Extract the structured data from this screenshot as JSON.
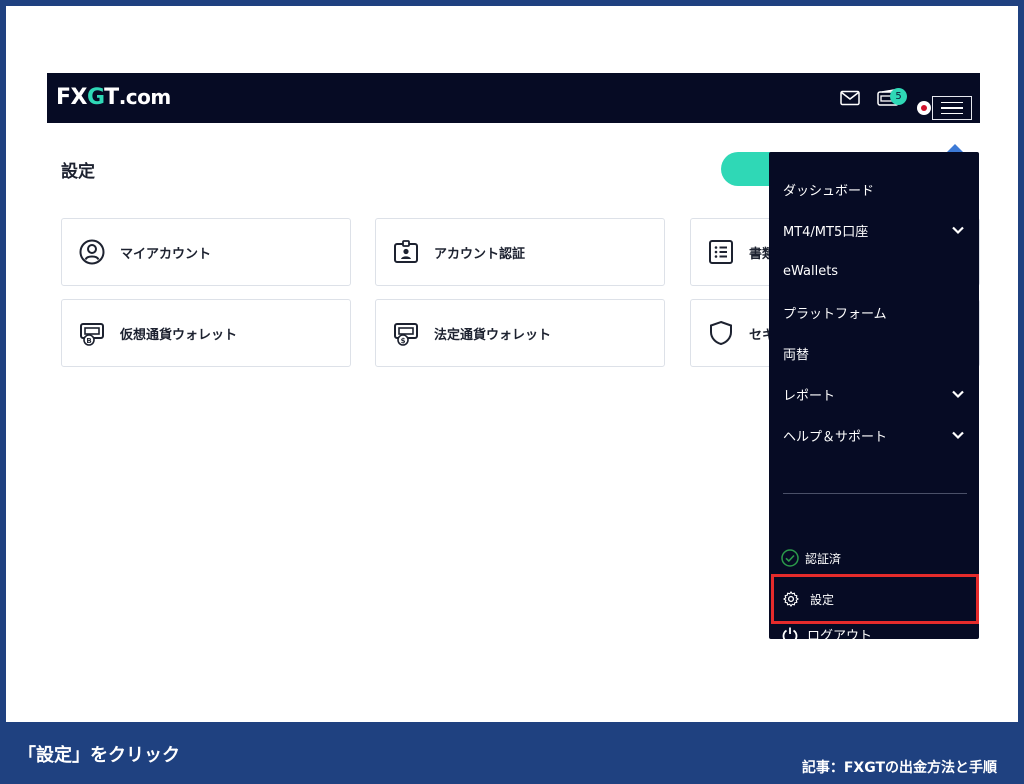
{
  "header": {
    "logo_fx": "FX",
    "logo_g": "G",
    "logo_t": "T",
    "logo_com": ".com",
    "notification_count": "5"
  },
  "page": {
    "title": "設定"
  },
  "cards": [
    {
      "label": "マイアカウント",
      "icon": "user-circle-icon"
    },
    {
      "label": "アカウント認証",
      "icon": "id-badge-icon"
    },
    {
      "label": "書類",
      "icon": "list-icon"
    },
    {
      "label": "仮想通貨ウォレット",
      "icon": "crypto-wallet-icon"
    },
    {
      "label": "法定通貨ウォレット",
      "icon": "fiat-wallet-icon"
    },
    {
      "label": "セキ",
      "icon": "shield-icon"
    }
  ],
  "menu": {
    "items": [
      {
        "label": "ダッシュボード",
        "has_submenu": false
      },
      {
        "label": "MT4/MT5口座",
        "has_submenu": true
      },
      {
        "label": "eWallets",
        "has_submenu": false
      },
      {
        "label": "プラットフォーム",
        "has_submenu": false
      },
      {
        "label": "両替",
        "has_submenu": false
      },
      {
        "label": "レポート",
        "has_submenu": true
      },
      {
        "label": "ヘルプ＆サポート",
        "has_submenu": true
      }
    ],
    "verified_label": "認証済",
    "settings_label": "設定",
    "logout_label": "ログアウト"
  },
  "caption": {
    "instruction": "「設定」をクリック",
    "article": "記事：FXGTの出金方法と手順"
  },
  "colors": {
    "navy": "#060b24",
    "accent": "#2fd8b6",
    "highlight": "#e52b2b",
    "frame": "#1f4180"
  }
}
